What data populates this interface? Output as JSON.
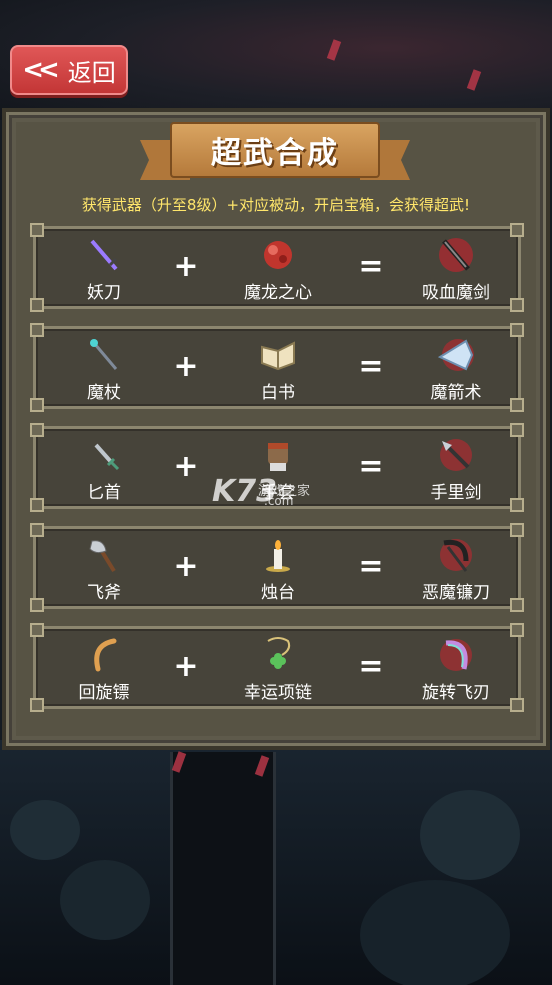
{
  "back": {
    "label": "返回"
  },
  "title": "超武合成",
  "subtitle": "获得武器（升至8级）+对应被动，开启宝箱，会获得超武!",
  "operators": {
    "plus": "+",
    "equals": "="
  },
  "recipes": [
    {
      "weapon": "妖刀",
      "weapon_icon": "sword-icon",
      "passive": "魔龙之心",
      "passive_icon": "dragon-heart-icon",
      "result": "吸血魔剑",
      "result_icon": "vampire-sword-icon"
    },
    {
      "weapon": "魔杖",
      "weapon_icon": "wand-icon",
      "passive": "白书",
      "passive_icon": "book-icon",
      "result": "魔箭术",
      "result_icon": "magic-arrow-icon"
    },
    {
      "weapon": "匕首",
      "weapon_icon": "dagger-icon",
      "passive": "手套",
      "passive_icon": "glove-icon",
      "result": "手里剑",
      "result_icon": "shuriken-icon"
    },
    {
      "weapon": "飞斧",
      "weapon_icon": "axe-icon",
      "passive": "烛台",
      "passive_icon": "candle-icon",
      "result": "恶魔镰刀",
      "result_icon": "scythe-icon"
    },
    {
      "weapon": "回旋镖",
      "weapon_icon": "boomerang-icon",
      "passive": "幸运项链",
      "passive_icon": "clover-necklace-icon",
      "result": "旋转飞刃",
      "result_icon": "spinning-blade-icon"
    }
  ],
  "watermark": {
    "logo": "K73",
    "text": "游戏之家",
    "domain": ".com"
  },
  "colors": {
    "subtitle": "#ffe66b",
    "back_button": "#d94a4a",
    "banner": "#c98f4e",
    "panel": "#5e5a4b"
  }
}
